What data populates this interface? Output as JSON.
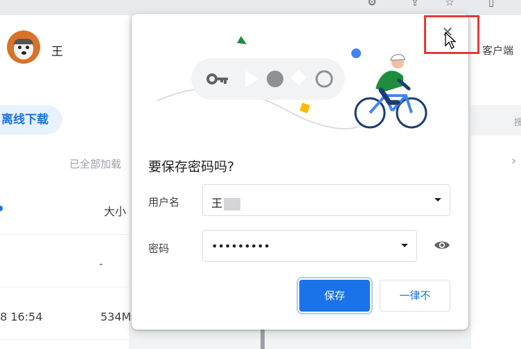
{
  "background": {
    "username": "王",
    "offline_download_button": "离线下载",
    "loaded_status": "已全部加载",
    "columns": {
      "size": "大小"
    },
    "rows": [
      {
        "date": "",
        "size": "-"
      },
      {
        "date": "8 16:54",
        "size": "534M"
      }
    ],
    "right_panel": {
      "client_label": "客户端",
      "header_char": "搜"
    }
  },
  "dialog": {
    "title": "要保存密码吗?",
    "username_label": "用户名",
    "username_value": "王",
    "password_label": "密码",
    "password_value": "•••••••••",
    "save_button": "保存",
    "never_button": "一律不",
    "close_icon": "close-icon"
  },
  "icons": {
    "key": "key-icon",
    "eye": "eye-icon",
    "dropdown": "chevron-down-icon"
  },
  "colors": {
    "accent": "#1a73e8",
    "highlight": "#e53935",
    "illustration_green": "#1e8e3e",
    "illustration_yellow": "#fbbc04"
  }
}
